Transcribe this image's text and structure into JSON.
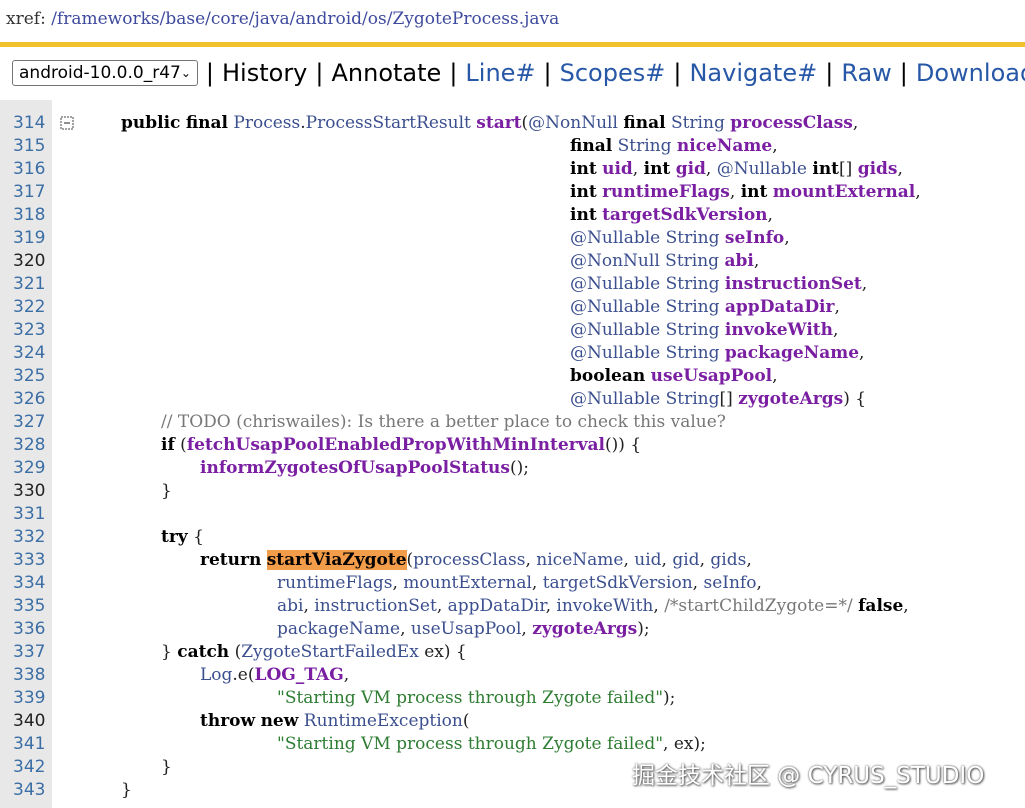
{
  "header": {
    "xref_label": "xref:",
    "path": "/frameworks/base/core/java/android/os/ZygoteProcess.java"
  },
  "nav": {
    "branch": "android-10.0.0_r47",
    "items": [
      "History",
      "Annotate",
      "Line#",
      "Scopes#",
      "Navigate#",
      "Raw",
      "Download"
    ]
  },
  "code_lines": [
    {
      "num": "314",
      "text": "public final Process.ProcessStartResult start(@NonNull final String processClass,"
    },
    {
      "num": "315",
      "text": "final String niceName,"
    },
    {
      "num": "316",
      "text": "int uid, int gid, @Nullable int[] gids,"
    },
    {
      "num": "317",
      "text": "int runtimeFlags, int mountExternal,"
    },
    {
      "num": "318",
      "text": "int targetSdkVersion,"
    },
    {
      "num": "319",
      "text": "@Nullable String seInfo,"
    },
    {
      "num": "320",
      "text": "@NonNull String abi,"
    },
    {
      "num": "321",
      "text": "@Nullable String instructionSet,"
    },
    {
      "num": "322",
      "text": "@Nullable String appDataDir,"
    },
    {
      "num": "323",
      "text": "@Nullable String invokeWith,"
    },
    {
      "num": "324",
      "text": "@Nullable String packageName,"
    },
    {
      "num": "325",
      "text": "boolean useUsapPool,"
    },
    {
      "num": "326",
      "text": "@Nullable String[] zygoteArgs) {"
    },
    {
      "num": "327",
      "text": "// TODO (chriswailes): Is there a better place to check this value?"
    },
    {
      "num": "328",
      "text": "if (fetchUsapPoolEnabledPropWithMinInterval()) {"
    },
    {
      "num": "329",
      "text": "informZygotesOfUsapPoolStatus();"
    },
    {
      "num": "330",
      "text": "}"
    },
    {
      "num": "331",
      "text": ""
    },
    {
      "num": "332",
      "text": "try {"
    },
    {
      "num": "333",
      "text": "return startViaZygote(processClass, niceName, uid, gid, gids,"
    },
    {
      "num": "334",
      "text": "runtimeFlags, mountExternal, targetSdkVersion, seInfo,"
    },
    {
      "num": "335",
      "text": "abi, instructionSet, appDataDir, invokeWith, /*startChildZygote=*/ false,"
    },
    {
      "num": "336",
      "text": "packageName, useUsapPool, zygoteArgs);"
    },
    {
      "num": "337",
      "text": "} catch (ZygoteStartFailedEx ex) {"
    },
    {
      "num": "338",
      "text": "Log.e(LOG_TAG,"
    },
    {
      "num": "339",
      "text": "\"Starting VM process through Zygote failed\");"
    },
    {
      "num": "340",
      "text": "throw new RuntimeException("
    },
    {
      "num": "341",
      "text": "\"Starting VM process through Zygote failed\", ex);"
    },
    {
      "num": "342",
      "text": "}"
    },
    {
      "num": "343",
      "text": "}"
    }
  ],
  "highlight_term": "startViaZygote",
  "watermark": "掘金技术社区 @ CYRUS_STUDIO"
}
